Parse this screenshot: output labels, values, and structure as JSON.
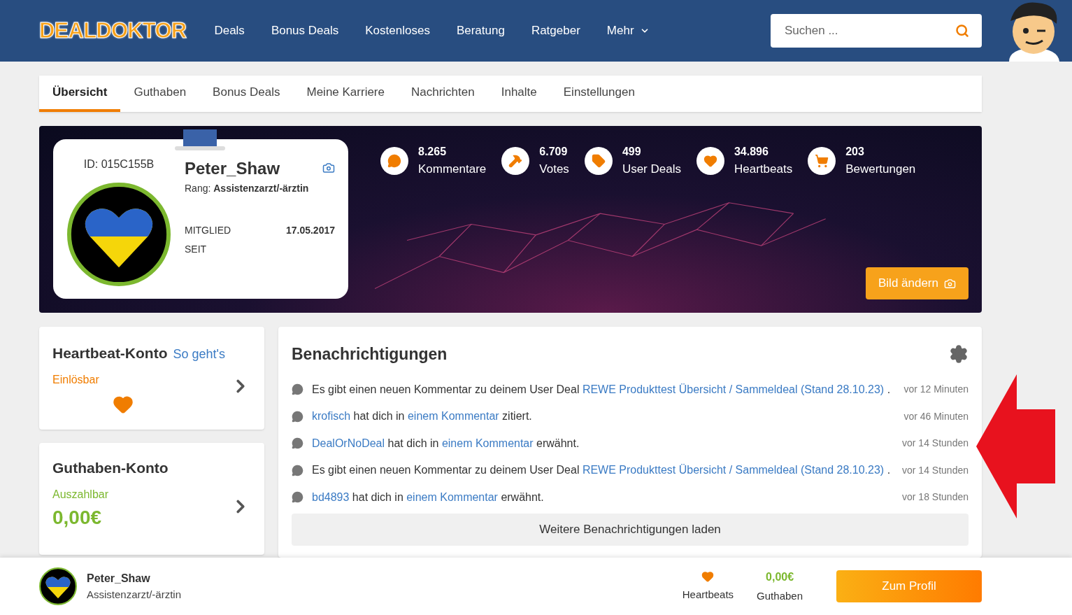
{
  "header": {
    "logo": "DEALDOKTOR",
    "nav": [
      {
        "label": "Deals",
        "dropdown": false
      },
      {
        "label": "Bonus Deals",
        "dropdown": false
      },
      {
        "label": "Kostenloses",
        "dropdown": false
      },
      {
        "label": "Beratung",
        "dropdown": false
      },
      {
        "label": "Ratgeber",
        "dropdown": false
      },
      {
        "label": "Mehr",
        "dropdown": true
      }
    ],
    "search": {
      "placeholder": "Suchen ..."
    }
  },
  "tabs": [
    {
      "label": "Übersicht",
      "selected": true
    },
    {
      "label": "Guthaben",
      "selected": false
    },
    {
      "label": "Bonus Deals",
      "selected": false
    },
    {
      "label": "Meine Karriere",
      "selected": false
    },
    {
      "label": "Nachrichten",
      "selected": false
    },
    {
      "label": "Inhalte",
      "selected": false
    },
    {
      "label": "Einstellungen",
      "selected": false
    }
  ],
  "profile": {
    "id": "ID: 015C155B",
    "name": "Peter_Shaw",
    "rank_label": "Rang:",
    "rank": "Assistenzarzt/-ärztin",
    "member_label": "MITGLIED SEIT",
    "member_since": "17.05.2017"
  },
  "stats": [
    {
      "kind": "comment",
      "value": "8.265",
      "label": "Kommentare"
    },
    {
      "kind": "hammer",
      "value": "6.709",
      "label": "Votes"
    },
    {
      "kind": "tag",
      "value": "499",
      "label": "User Deals"
    },
    {
      "kind": "heart",
      "value": "34.896",
      "label": "Heartbeats"
    },
    {
      "kind": "cart",
      "value": "203",
      "label": "Bewertungen"
    }
  ],
  "change_image_button": "Bild ändern",
  "heartbeat_account": {
    "title": "Heartbeat-Konto",
    "help_link": "So geht's",
    "sub": "Einlösbar"
  },
  "credit_account": {
    "title": "Guthaben-Konto",
    "sub": "Auszahlbar",
    "amount": "0,00€"
  },
  "notifications": {
    "title": "Benachrichtigungen",
    "items": [
      {
        "parts": [
          {
            "text": "Es gibt einen neuen Kommentar zu deinem User Deal ",
            "link": false
          },
          {
            "text": "REWE Produkttest Übersicht / Sammeldeal (Stand 28.10.23)",
            "link": true
          },
          {
            "text": " .",
            "link": false
          }
        ],
        "time": "vor 12 Minuten"
      },
      {
        "parts": [
          {
            "text": "krofisch",
            "link": true
          },
          {
            "text": " hat dich in ",
            "link": false
          },
          {
            "text": "einem Kommentar",
            "link": true
          },
          {
            "text": " zitiert.",
            "link": false
          }
        ],
        "time": "vor 46 Minuten"
      },
      {
        "parts": [
          {
            "text": "DealOrNoDeal",
            "link": true
          },
          {
            "text": " hat dich in ",
            "link": false
          },
          {
            "text": "einem Kommentar",
            "link": true
          },
          {
            "text": " erwähnt.",
            "link": false
          }
        ],
        "time": "vor 14 Stunden"
      },
      {
        "parts": [
          {
            "text": "Es gibt einen neuen Kommentar zu deinem User Deal ",
            "link": false
          },
          {
            "text": "REWE Produkttest Übersicht / Sammeldeal (Stand 28.10.23)",
            "link": true
          },
          {
            "text": " .",
            "link": false
          }
        ],
        "time": "vor 14 Stunden"
      },
      {
        "parts": [
          {
            "text": "bd4893",
            "link": true
          },
          {
            "text": " hat dich in ",
            "link": false
          },
          {
            "text": "einem Kommentar",
            "link": true
          },
          {
            "text": " erwähnt.",
            "link": false
          }
        ],
        "time": "vor 18 Stunden"
      }
    ],
    "load_more": "Weitere Benachrichtigungen laden"
  },
  "footer_bar": {
    "name": "Peter_Shaw",
    "rank": "Assistenzarzt/-ärztin",
    "heartbeats_label": "Heartbeats",
    "credit_value": "0,00€",
    "credit_label": "Guthaben",
    "profile_button": "Zum Profil"
  }
}
